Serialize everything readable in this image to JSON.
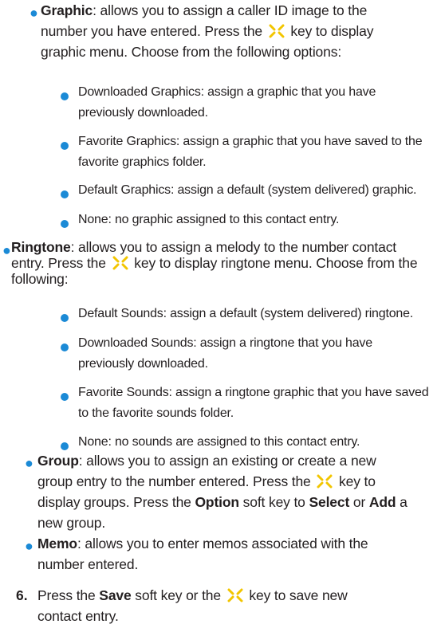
{
  "graphic": {
    "label": "Graphic",
    "text_a": ": allows you to assign a caller ID image to the number you have entered. Press the ",
    "text_b": " key to display graphic menu. Choose from the following options:",
    "options": [
      "Downloaded Graphics: assign a graphic that you have previously downloaded.",
      "Favorite Graphics: assign a graphic that you have saved to the favorite graphics folder.",
      "Default Graphics: assign a default (system delivered) graphic.",
      "None: no graphic assigned to this contact entry."
    ]
  },
  "ringtone": {
    "label": "Ringtone",
    "text_a": ": allows you to assign a melody to the number contact entry. Press the ",
    "text_b": " key to display ringtone menu. Choose from the following:",
    "options": [
      "Default Sounds: assign a default (system delivered) ringtone.",
      "Downloaded Sounds: assign a ringtone that you have previously downloaded.",
      "Favorite Sounds: assign a ringtone graphic that you have saved to the favorite sounds folder.",
      "None: no sounds are assigned to this contact entry."
    ]
  },
  "group": {
    "label": "Group",
    "text_a": ": allows you to assign an existing or create a new group entry to the number entered. Press the ",
    "text_b": " key to display groups. Press the ",
    "option_word": "Option",
    "text_c": " soft key to ",
    "select_word": "Select",
    "text_d": " or ",
    "add_word": "Add",
    "text_e": " a new group."
  },
  "memo": {
    "label": "Memo",
    "text": ": allows you to enter memos associated with the number entered."
  },
  "step6": {
    "number": "6.",
    "text_a": "Press the ",
    "save_word": "Save",
    "text_b": " soft key or the ",
    "text_c": " key to save new contact entry."
  },
  "colors": {
    "bullet": "#1b8ad6",
    "key_icon": "#f2c500",
    "text": "#231f20"
  },
  "icons": {
    "bullet": "bullet-dot",
    "key": "navigation-key-icon"
  }
}
